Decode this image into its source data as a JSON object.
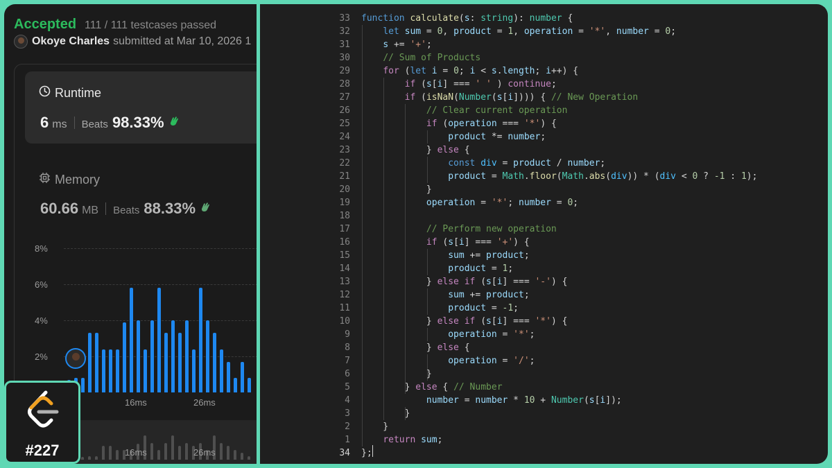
{
  "submission": {
    "status": "Accepted",
    "testcases": "111 / 111 testcases passed",
    "user": "Okoye Charles",
    "submitted_at": "submitted at Mar 10, 2026 1"
  },
  "runtime": {
    "title": "Runtime",
    "value": "6",
    "unit": "ms",
    "beats_label": "Beats",
    "beats": "98.33%"
  },
  "memory": {
    "title": "Memory",
    "value": "60.66",
    "unit": "MB",
    "beats_label": "Beats",
    "beats": "88.33%"
  },
  "distribution": {
    "y_ticks": [
      "8%",
      "6%",
      "4%",
      "2%"
    ],
    "x_ticks": [
      "16ms",
      "26ms"
    ],
    "mini_x_ticks": [
      "16ms",
      "26ms"
    ],
    "values": [
      0.7,
      0.8,
      0.8,
      3.3,
      3.3,
      2.4,
      2.4,
      2.4,
      3.9,
      5.8,
      4.0,
      2.4,
      4.0,
      5.8,
      3.3,
      4.0,
      3.3,
      4.0,
      2.4,
      5.8,
      4.0,
      3.3,
      2.4,
      1.7,
      0.8,
      1.7,
      0.8,
      0.7
    ]
  },
  "problem": {
    "number": "#227"
  },
  "code": {
    "lines": [
      {
        "n": "33",
        "segs": [
          [
            "kw",
            "function "
          ],
          [
            "fn",
            "calculate"
          ],
          [
            "",
            "("
          ],
          [
            "var",
            "s"
          ],
          [
            "",
            ": "
          ],
          [
            "typ",
            "string"
          ],
          [
            "",
            "): "
          ],
          [
            "typ",
            "number"
          ],
          [
            "",
            " {"
          ]
        ]
      },
      {
        "n": "32",
        "segs": [
          [
            "",
            "    "
          ],
          [
            "kw",
            "let "
          ],
          [
            "var",
            "sum"
          ],
          [
            "",
            " = "
          ],
          [
            "num",
            "0"
          ],
          [
            "",
            ", "
          ],
          [
            "var",
            "product"
          ],
          [
            "",
            " = "
          ],
          [
            "num",
            "1"
          ],
          [
            "",
            ", "
          ],
          [
            "var",
            "operation"
          ],
          [
            "",
            " = "
          ],
          [
            "str",
            "'*'"
          ],
          [
            "",
            ", "
          ],
          [
            "var",
            "number"
          ],
          [
            "",
            " = "
          ],
          [
            "num",
            "0"
          ],
          [
            "",
            ";"
          ]
        ]
      },
      {
        "n": "31",
        "segs": [
          [
            "",
            "    "
          ],
          [
            "var",
            "s"
          ],
          [
            "",
            " += "
          ],
          [
            "str",
            "'+'"
          ],
          [
            "",
            ";"
          ]
        ]
      },
      {
        "n": "30",
        "segs": [
          [
            "",
            "    "
          ],
          [
            "cmt",
            "// Sum of Products"
          ]
        ]
      },
      {
        "n": "29",
        "segs": [
          [
            "",
            "    "
          ],
          [
            "ctl",
            "for"
          ],
          [
            "",
            " ("
          ],
          [
            "kw",
            "let "
          ],
          [
            "var",
            "i"
          ],
          [
            "",
            " = "
          ],
          [
            "num",
            "0"
          ],
          [
            "",
            "; "
          ],
          [
            "var",
            "i"
          ],
          [
            "",
            " < "
          ],
          [
            "var",
            "s"
          ],
          [
            "",
            "."
          ],
          [
            "var",
            "length"
          ],
          [
            "",
            "; "
          ],
          [
            "var",
            "i"
          ],
          [
            "",
            "++) {"
          ]
        ]
      },
      {
        "n": "28",
        "segs": [
          [
            "",
            "        "
          ],
          [
            "ctl",
            "if"
          ],
          [
            "",
            " ("
          ],
          [
            "var",
            "s"
          ],
          [
            "",
            "["
          ],
          [
            "var",
            "i"
          ],
          [
            "",
            "] === "
          ],
          [
            "str",
            "' '"
          ],
          [
            "",
            " ) "
          ],
          [
            "ctl",
            "continue"
          ],
          [
            "",
            ";"
          ]
        ]
      },
      {
        "n": "27",
        "segs": [
          [
            "",
            "        "
          ],
          [
            "ctl",
            "if"
          ],
          [
            "",
            " ("
          ],
          [
            "fn",
            "isNaN"
          ],
          [
            "",
            "("
          ],
          [
            "typ",
            "Number"
          ],
          [
            "",
            "("
          ],
          [
            "var",
            "s"
          ],
          [
            "",
            "["
          ],
          [
            "var",
            "i"
          ],
          [
            "",
            "]))) { "
          ],
          [
            "cmt",
            "// New Operation"
          ]
        ]
      },
      {
        "n": "26",
        "segs": [
          [
            "",
            "            "
          ],
          [
            "cmt",
            "// Clear current operation"
          ]
        ]
      },
      {
        "n": "25",
        "segs": [
          [
            "",
            "            "
          ],
          [
            "ctl",
            "if"
          ],
          [
            "",
            " ("
          ],
          [
            "var",
            "operation"
          ],
          [
            "",
            " === "
          ],
          [
            "str",
            "'*'"
          ],
          [
            "",
            ") {"
          ]
        ]
      },
      {
        "n": "24",
        "segs": [
          [
            "",
            "                "
          ],
          [
            "var",
            "product"
          ],
          [
            "",
            " *= "
          ],
          [
            "var",
            "number"
          ],
          [
            "",
            ";"
          ]
        ]
      },
      {
        "n": "23",
        "segs": [
          [
            "",
            "            } "
          ],
          [
            "ctl",
            "else"
          ],
          [
            "",
            " {"
          ]
        ]
      },
      {
        "n": "22",
        "segs": [
          [
            "",
            "                "
          ],
          [
            "kw",
            "const "
          ],
          [
            "cst",
            "div"
          ],
          [
            "",
            " = "
          ],
          [
            "var",
            "product"
          ],
          [
            "",
            " / "
          ],
          [
            "var",
            "number"
          ],
          [
            "",
            ";"
          ]
        ]
      },
      {
        "n": "21",
        "segs": [
          [
            "",
            "                "
          ],
          [
            "var",
            "product"
          ],
          [
            "",
            " = "
          ],
          [
            "typ",
            "Math"
          ],
          [
            "",
            "."
          ],
          [
            "fn",
            "floor"
          ],
          [
            "",
            "("
          ],
          [
            "typ",
            "Math"
          ],
          [
            "",
            "."
          ],
          [
            "fn",
            "abs"
          ],
          [
            "",
            "("
          ],
          [
            "cst",
            "div"
          ],
          [
            "",
            ")) * ("
          ],
          [
            "cst",
            "div"
          ],
          [
            "",
            " < "
          ],
          [
            "num",
            "0"
          ],
          [
            "",
            " ? "
          ],
          [
            "num",
            "-1"
          ],
          [
            "",
            " : "
          ],
          [
            "num",
            "1"
          ],
          [
            "",
            ");"
          ]
        ]
      },
      {
        "n": "20",
        "segs": [
          [
            "",
            "            }"
          ]
        ]
      },
      {
        "n": "19",
        "segs": [
          [
            "",
            "            "
          ],
          [
            "var",
            "operation"
          ],
          [
            "",
            " = "
          ],
          [
            "str",
            "'*'"
          ],
          [
            "",
            "; "
          ],
          [
            "var",
            "number"
          ],
          [
            "",
            " = "
          ],
          [
            "num",
            "0"
          ],
          [
            "",
            ";"
          ]
        ]
      },
      {
        "n": "18",
        "segs": []
      },
      {
        "n": "17",
        "segs": [
          [
            "",
            "            "
          ],
          [
            "cmt",
            "// Perform new operation"
          ]
        ]
      },
      {
        "n": "16",
        "segs": [
          [
            "",
            "            "
          ],
          [
            "ctl",
            "if"
          ],
          [
            "",
            " ("
          ],
          [
            "var",
            "s"
          ],
          [
            "",
            "["
          ],
          [
            "var",
            "i"
          ],
          [
            "",
            "] === "
          ],
          [
            "str",
            "'+'"
          ],
          [
            "",
            ") {"
          ]
        ]
      },
      {
        "n": "15",
        "segs": [
          [
            "",
            "                "
          ],
          [
            "var",
            "sum"
          ],
          [
            "",
            " += "
          ],
          [
            "var",
            "product"
          ],
          [
            "",
            ";"
          ]
        ]
      },
      {
        "n": "14",
        "segs": [
          [
            "",
            "                "
          ],
          [
            "var",
            "product"
          ],
          [
            "",
            " = "
          ],
          [
            "num",
            "1"
          ],
          [
            "",
            ";"
          ]
        ]
      },
      {
        "n": "13",
        "segs": [
          [
            "",
            "            } "
          ],
          [
            "ctl",
            "else if"
          ],
          [
            "",
            " ("
          ],
          [
            "var",
            "s"
          ],
          [
            "",
            "["
          ],
          [
            "var",
            "i"
          ],
          [
            "",
            "] === "
          ],
          [
            "str",
            "'-'"
          ],
          [
            "",
            ") {"
          ]
        ]
      },
      {
        "n": "12",
        "segs": [
          [
            "",
            "                "
          ],
          [
            "var",
            "sum"
          ],
          [
            "",
            " += "
          ],
          [
            "var",
            "product"
          ],
          [
            "",
            ";"
          ]
        ]
      },
      {
        "n": "11",
        "segs": [
          [
            "",
            "                "
          ],
          [
            "var",
            "product"
          ],
          [
            "",
            " = "
          ],
          [
            "num",
            "-1"
          ],
          [
            "",
            ";"
          ]
        ]
      },
      {
        "n": "10",
        "segs": [
          [
            "",
            "            } "
          ],
          [
            "ctl",
            "else if"
          ],
          [
            "",
            " ("
          ],
          [
            "var",
            "s"
          ],
          [
            "",
            "["
          ],
          [
            "var",
            "i"
          ],
          [
            "",
            "] === "
          ],
          [
            "str",
            "'*'"
          ],
          [
            "",
            ") {"
          ]
        ]
      },
      {
        "n": "9",
        "segs": [
          [
            "",
            "                "
          ],
          [
            "var",
            "operation"
          ],
          [
            "",
            " = "
          ],
          [
            "str",
            "'*'"
          ],
          [
            "",
            ";"
          ]
        ]
      },
      {
        "n": "8",
        "segs": [
          [
            "",
            "            } "
          ],
          [
            "ctl",
            "else"
          ],
          [
            "",
            " {"
          ]
        ]
      },
      {
        "n": "7",
        "segs": [
          [
            "",
            "                "
          ],
          [
            "var",
            "operation"
          ],
          [
            "",
            " = "
          ],
          [
            "str",
            "'/'"
          ],
          [
            "",
            ";"
          ]
        ]
      },
      {
        "n": "6",
        "segs": [
          [
            "",
            "            }"
          ]
        ]
      },
      {
        "n": "5",
        "segs": [
          [
            "",
            "        } "
          ],
          [
            "ctl",
            "else"
          ],
          [
            "",
            " { "
          ],
          [
            "cmt",
            "// Number"
          ]
        ]
      },
      {
        "n": "4",
        "segs": [
          [
            "",
            "            "
          ],
          [
            "var",
            "number"
          ],
          [
            "",
            " = "
          ],
          [
            "var",
            "number"
          ],
          [
            "",
            " * "
          ],
          [
            "num",
            "10"
          ],
          [
            "",
            " + "
          ],
          [
            "typ",
            "Number"
          ],
          [
            "",
            "("
          ],
          [
            "var",
            "s"
          ],
          [
            "",
            "["
          ],
          [
            "var",
            "i"
          ],
          [
            "",
            "]);"
          ]
        ]
      },
      {
        "n": "3",
        "segs": [
          [
            "",
            "        }"
          ]
        ]
      },
      {
        "n": "2",
        "segs": [
          [
            "",
            "    }"
          ]
        ]
      },
      {
        "n": "1",
        "segs": [
          [
            "",
            "    "
          ],
          [
            "ctl",
            "return "
          ],
          [
            "var",
            "sum"
          ],
          [
            "",
            ";"
          ]
        ]
      },
      {
        "n": "34",
        "segs": [
          [
            "",
            "};"
          ]
        ],
        "current": true
      }
    ]
  },
  "colors": {
    "accent": "#5fd8b4",
    "accepted": "#2cbb5d",
    "bar": "#1e88f0",
    "beats_icon": "#2cbb5d"
  }
}
